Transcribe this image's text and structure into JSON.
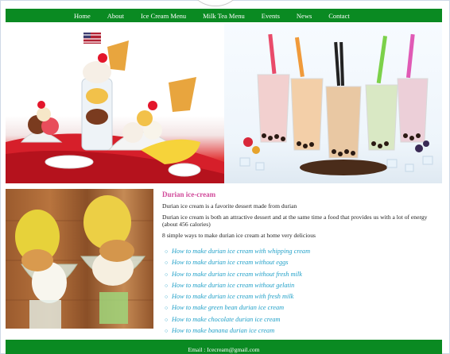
{
  "nav": {
    "items": [
      "Home",
      "About",
      "Ice Cream Menu",
      "Milk Tea Menu",
      "Events",
      "News",
      "Contact"
    ]
  },
  "banner": {
    "left_alt": "ice-cream-sundaes-image",
    "right_alt": "bubble-milk-tea-image"
  },
  "article": {
    "image_alt": "durian-ice-cream-image",
    "title": "Durian ice-cream",
    "intro": "Durian ice cream is a favorite dessert made from durian",
    "description": "Durian ice cream is both an attractive dessert and at the same time a food that provides us with a lot of energy (about 456 calories)",
    "ways": "8 simple ways to make durian ice cream at home very delicious",
    "links": [
      "How to make durian ice cream with whipping cream",
      "How to make durian ice cream without eggs",
      "How to make durian ice cream without fresh milk",
      "How to make durian ice cream without gelatin",
      "How to make durian ice cream with fresh milk",
      "How to make green bean durian ice cream",
      "How to make chocolate durian ice cream",
      "How to make banana durian ice cream"
    ],
    "bullet": "○"
  },
  "footer": {
    "email": "Email : Icecream@gmail.com"
  },
  "colors": {
    "nav": "#0a8a22",
    "title": "#d14a9a",
    "link": "#20a0c8"
  }
}
